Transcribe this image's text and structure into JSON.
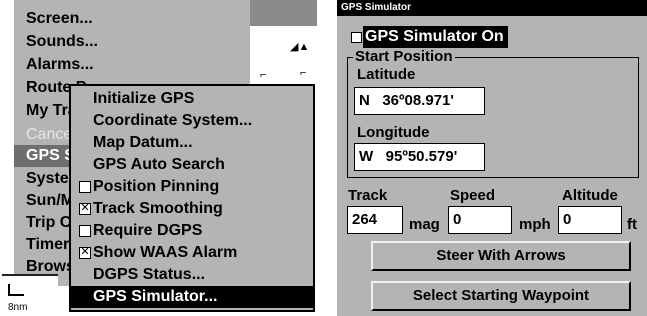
{
  "left_panel": {
    "main_menu": {
      "items": [
        {
          "label": "Screen..."
        },
        {
          "label": "Sounds..."
        },
        {
          "label": "Alarms..."
        },
        {
          "label": "Route Planning"
        },
        {
          "label": "My Trails"
        },
        {
          "label": "Cancel"
        },
        {
          "label": "GPS Setup"
        },
        {
          "label": "System Setup"
        },
        {
          "label": "Sun/Moon"
        },
        {
          "label": "Trip Calculator"
        },
        {
          "label": "Timers"
        },
        {
          "label": "Browse"
        }
      ]
    },
    "map_scale": "8nm",
    "submenu": {
      "items": [
        {
          "label": "Initialize GPS",
          "checkbox": null
        },
        {
          "label": "Coordinate System...",
          "checkbox": null
        },
        {
          "label": "Map Datum...",
          "checkbox": null
        },
        {
          "label": "GPS Auto Search",
          "checkbox": null
        },
        {
          "label": "Position Pinning",
          "checkbox": false
        },
        {
          "label": "Track Smoothing",
          "checkbox": true
        },
        {
          "label": "Require DGPS",
          "checkbox": false
        },
        {
          "label": "Show WAAS Alarm",
          "checkbox": true
        },
        {
          "label": "DGPS Status...",
          "checkbox": null
        },
        {
          "label": "GPS Simulator...",
          "checkbox": null,
          "selected": true
        }
      ]
    }
  },
  "right_panel": {
    "title": "GPS Simulator",
    "simulator_toggle": {
      "label": "GPS Simulator On",
      "checked": false
    },
    "start_position": {
      "legend": "Start Position",
      "latitude_label": "Latitude",
      "latitude_value": "N   36º08.971'",
      "longitude_label": "Longitude",
      "longitude_value": "W   95º50.579'"
    },
    "track": {
      "label": "Track",
      "value": "264",
      "unit": "mag"
    },
    "speed": {
      "label": "Speed",
      "value": "0",
      "unit": "mph"
    },
    "altitude": {
      "label": "Altitude",
      "value": "0",
      "unit": "ft"
    },
    "buttons": {
      "steer": "Steer With Arrows",
      "select_waypoint": "Select Starting Waypoint"
    }
  }
}
